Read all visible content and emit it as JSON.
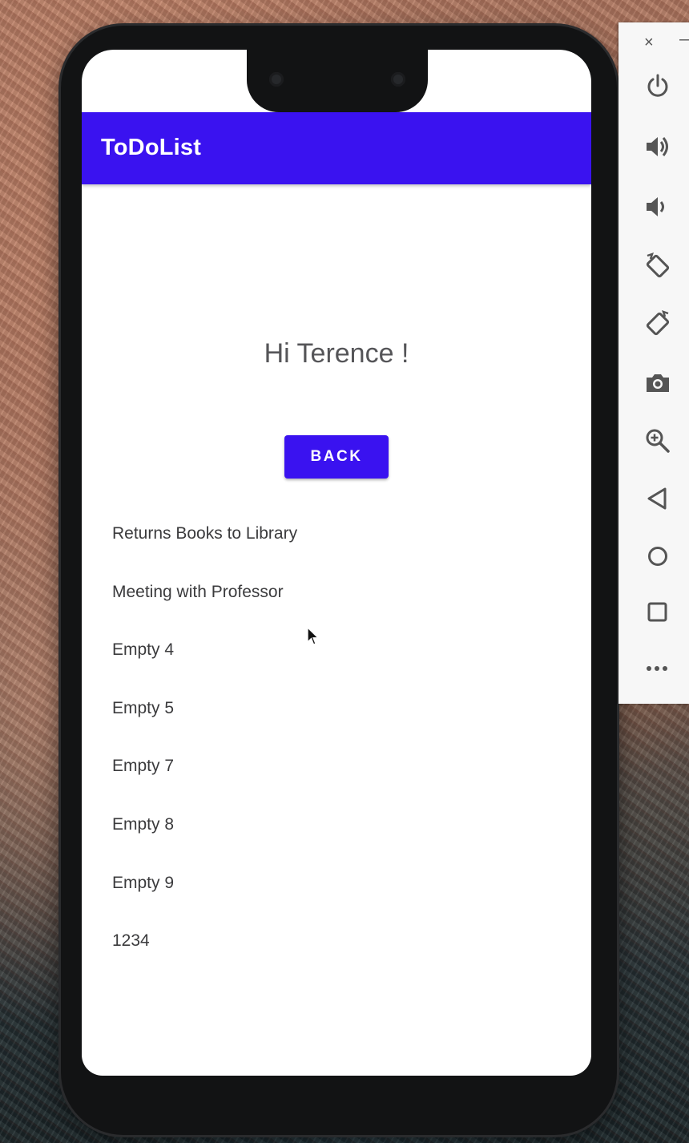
{
  "app": {
    "title": "ToDoList",
    "accent_color": "#3a12f0"
  },
  "main": {
    "greeting": "Hi Terence !",
    "back_button_label": "BACK",
    "tasks": [
      "Returns Books to Library",
      "Meeting with Professor",
      "Empty 4",
      "Empty 5",
      "Empty 7",
      "Empty 8",
      "Empty 9",
      "1234"
    ]
  },
  "emulator_toolbar": {
    "close_glyph": "×",
    "minimize_glyph": "—",
    "icons": [
      "power-icon",
      "volume-up-icon",
      "volume-down-icon",
      "rotate-left-icon",
      "rotate-right-icon",
      "camera-icon",
      "zoom-icon",
      "back-icon",
      "home-icon",
      "overview-icon",
      "more-icon"
    ]
  }
}
